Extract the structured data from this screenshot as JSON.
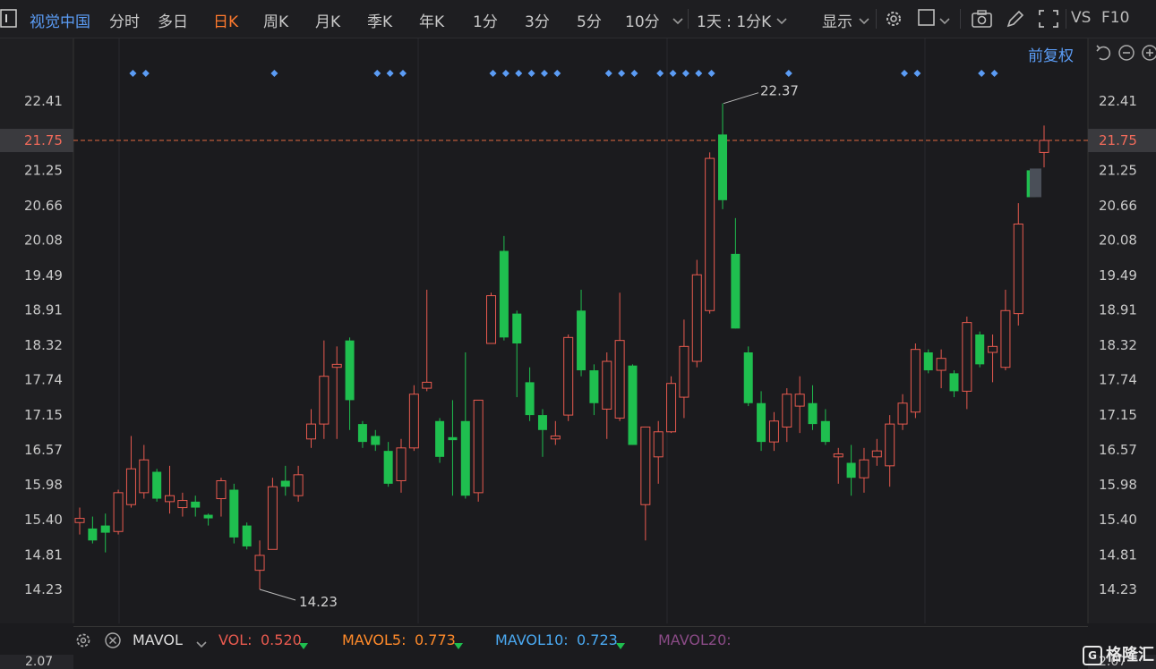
{
  "toolbar": {
    "title": "视觉中国",
    "tabs": [
      "分时",
      "多日",
      "日K",
      "周K",
      "月K",
      "季K",
      "年K",
      "1分",
      "3分",
      "5分",
      "10分"
    ],
    "active_tab": "日K",
    "period_select": "1天 : 1分K",
    "display_label": "显示",
    "vs": "VS",
    "f10": "F10"
  },
  "fq_label": "前复权",
  "price_axis": {
    "ticks": [
      "22.41",
      "21.75",
      "21.25",
      "20.66",
      "20.08",
      "19.49",
      "18.91",
      "18.32",
      "17.74",
      "17.15",
      "16.57",
      "15.98",
      "15.40",
      "14.81",
      "14.23"
    ],
    "current": "21.75",
    "max_label": "22.37",
    "min_label": "14.23"
  },
  "chart_data": {
    "type": "candlestick",
    "ylim": [
      13.5,
      23.4
    ],
    "candles": [
      {
        "o": 15.35,
        "c": 15.42,
        "h": 15.6,
        "l": 15.15
      },
      {
        "o": 15.25,
        "c": 15.05,
        "h": 15.45,
        "l": 15.0
      },
      {
        "o": 15.3,
        "c": 15.18,
        "h": 15.5,
        "l": 14.85
      },
      {
        "o": 15.2,
        "c": 15.85,
        "h": 15.9,
        "l": 15.15
      },
      {
        "o": 15.65,
        "c": 16.25,
        "h": 16.8,
        "l": 15.6
      },
      {
        "o": 15.85,
        "c": 16.4,
        "h": 16.65,
        "l": 15.75
      },
      {
        "o": 16.2,
        "c": 15.75,
        "h": 16.25,
        "l": 15.7
      },
      {
        "o": 15.7,
        "c": 15.8,
        "h": 16.3,
        "l": 15.5
      },
      {
        "o": 15.6,
        "c": 15.72,
        "h": 15.85,
        "l": 15.45
      },
      {
        "o": 15.7,
        "c": 15.6,
        "h": 15.8,
        "l": 15.45
      },
      {
        "o": 15.48,
        "c": 15.42,
        "h": 15.5,
        "l": 15.3
      },
      {
        "o": 15.75,
        "c": 16.05,
        "h": 16.1,
        "l": 15.45
      },
      {
        "o": 15.9,
        "c": 15.1,
        "h": 16.0,
        "l": 15.0
      },
      {
        "o": 15.3,
        "c": 14.95,
        "h": 15.35,
        "l": 14.9
      },
      {
        "o": 14.55,
        "c": 14.8,
        "h": 15.05,
        "l": 14.23
      },
      {
        "o": 14.9,
        "c": 15.95,
        "h": 16.1,
        "l": 14.9
      },
      {
        "o": 16.05,
        "c": 15.95,
        "h": 16.3,
        "l": 15.8
      },
      {
        "o": 15.8,
        "c": 16.15,
        "h": 16.3,
        "l": 15.7
      },
      {
        "o": 16.75,
        "c": 17.0,
        "h": 17.25,
        "l": 16.6
      },
      {
        "o": 17.0,
        "c": 17.8,
        "h": 18.4,
        "l": 16.75
      },
      {
        "o": 17.95,
        "c": 18.0,
        "h": 18.3,
        "l": 16.75
      },
      {
        "o": 18.4,
        "c": 17.4,
        "h": 18.45,
        "l": 16.9
      },
      {
        "o": 17.0,
        "c": 16.7,
        "h": 17.05,
        "l": 16.6
      },
      {
        "o": 16.8,
        "c": 16.65,
        "h": 16.9,
        "l": 16.55
      },
      {
        "o": 16.55,
        "c": 16.0,
        "h": 16.7,
        "l": 15.95
      },
      {
        "o": 16.05,
        "c": 16.6,
        "h": 16.75,
        "l": 15.85
      },
      {
        "o": 16.6,
        "c": 17.5,
        "h": 17.65,
        "l": 16.55
      },
      {
        "o": 17.6,
        "c": 17.7,
        "h": 19.25,
        "l": 17.55
      },
      {
        "o": 17.05,
        "c": 16.45,
        "h": 17.1,
        "l": 16.35
      },
      {
        "o": 16.78,
        "c": 16.73,
        "h": 17.4,
        "l": 15.8
      },
      {
        "o": 17.05,
        "c": 15.8,
        "h": 18.2,
        "l": 15.75
      },
      {
        "o": 15.85,
        "c": 17.4,
        "h": 17.4,
        "l": 15.7
      },
      {
        "o": 18.35,
        "c": 19.15,
        "h": 19.2,
        "l": 18.35
      },
      {
        "o": 19.9,
        "c": 18.45,
        "h": 20.15,
        "l": 18.4
      },
      {
        "o": 18.85,
        "c": 18.35,
        "h": 18.9,
        "l": 17.45
      },
      {
        "o": 17.7,
        "c": 17.15,
        "h": 17.95,
        "l": 17.05
      },
      {
        "o": 17.15,
        "c": 16.9,
        "h": 17.25,
        "l": 16.45
      },
      {
        "o": 16.75,
        "c": 16.8,
        "h": 17.05,
        "l": 16.65
      },
      {
        "o": 17.15,
        "c": 18.45,
        "h": 18.5,
        "l": 17.05
      },
      {
        "o": 18.9,
        "c": 17.9,
        "h": 19.25,
        "l": 17.8
      },
      {
        "o": 17.9,
        "c": 17.35,
        "h": 18.0,
        "l": 17.15
      },
      {
        "o": 17.25,
        "c": 18.05,
        "h": 18.2,
        "l": 16.75
      },
      {
        "o": 17.1,
        "c": 18.4,
        "h": 19.2,
        "l": 17.05
      },
      {
        "o": 17.98,
        "c": 16.65,
        "h": 18.0,
        "l": 16.65
      },
      {
        "o": 15.65,
        "c": 16.95,
        "h": 16.95,
        "l": 15.05
      },
      {
        "o": 16.45,
        "c": 16.87,
        "h": 17.05,
        "l": 16.0
      },
      {
        "o": 16.87,
        "c": 17.68,
        "h": 17.8,
        "l": 16.85
      },
      {
        "o": 17.45,
        "c": 18.3,
        "h": 18.75,
        "l": 17.1
      },
      {
        "o": 18.05,
        "c": 19.5,
        "h": 19.75,
        "l": 17.95
      },
      {
        "o": 18.9,
        "c": 21.45,
        "h": 21.55,
        "l": 18.85
      },
      {
        "o": 21.85,
        "c": 20.75,
        "h": 22.37,
        "l": 20.6
      },
      {
        "o": 19.85,
        "c": 18.6,
        "h": 20.45,
        "l": 18.6
      },
      {
        "o": 18.2,
        "c": 17.35,
        "h": 18.3,
        "l": 17.3
      },
      {
        "o": 17.35,
        "c": 16.7,
        "h": 17.55,
        "l": 16.55
      },
      {
        "o": 16.7,
        "c": 17.05,
        "h": 17.2,
        "l": 16.55
      },
      {
        "o": 16.95,
        "c": 17.5,
        "h": 17.6,
        "l": 16.7
      },
      {
        "o": 17.3,
        "c": 17.5,
        "h": 17.8,
        "l": 16.85
      },
      {
        "o": 17.35,
        "c": 17.0,
        "h": 17.65,
        "l": 16.9
      },
      {
        "o": 17.05,
        "c": 16.7,
        "h": 17.25,
        "l": 16.65
      },
      {
        "o": 16.45,
        "c": 16.5,
        "h": 16.6,
        "l": 16.0
      },
      {
        "o": 16.35,
        "c": 16.1,
        "h": 16.65,
        "l": 15.8
      },
      {
        "o": 16.1,
        "c": 16.4,
        "h": 16.6,
        "l": 15.85
      },
      {
        "o": 16.45,
        "c": 16.55,
        "h": 16.75,
        "l": 16.3
      },
      {
        "o": 16.3,
        "c": 17.0,
        "h": 17.15,
        "l": 15.95
      },
      {
        "o": 17.0,
        "c": 17.35,
        "h": 17.5,
        "l": 16.9
      },
      {
        "o": 17.2,
        "c": 18.25,
        "h": 18.35,
        "l": 17.1
      },
      {
        "o": 18.2,
        "c": 17.9,
        "h": 18.25,
        "l": 17.85
      },
      {
        "o": 17.9,
        "c": 18.1,
        "h": 18.25,
        "l": 17.6
      },
      {
        "o": 17.85,
        "c": 17.55,
        "h": 17.9,
        "l": 17.45
      },
      {
        "o": 17.55,
        "c": 18.7,
        "h": 18.8,
        "l": 17.25
      },
      {
        "o": 18.5,
        "c": 18.0,
        "h": 18.55,
        "l": 17.95
      },
      {
        "o": 18.2,
        "c": 18.3,
        "h": 18.5,
        "l": 17.7
      },
      {
        "o": 17.95,
        "c": 18.9,
        "h": 19.25,
        "l": 17.9
      },
      {
        "o": 18.85,
        "c": 20.35,
        "h": 20.7,
        "l": 18.65
      },
      {
        "o": 21.25,
        "c": 20.8,
        "h": 21.25,
        "l": 20.8
      },
      {
        "o": 21.55,
        "c": 21.75,
        "h": 22.0,
        "l": 21.3
      }
    ],
    "marker_indexes": [
      4,
      5,
      15,
      23,
      24,
      25,
      32,
      33,
      34,
      35,
      36,
      37,
      41,
      42,
      43,
      45,
      46,
      47,
      48,
      49,
      55,
      64,
      65,
      70,
      71
    ]
  },
  "vol_bar": {
    "name": "MAVOL",
    "vol_label": "VOL:",
    "vol_value": "0.520",
    "ma5_label": "MAVOL5:",
    "ma5_value": "0.773",
    "ma10_label": "MAVOL10:",
    "ma10_value": "0.723",
    "ma20_label": "MAVOL20:",
    "axis_value": "2.07"
  },
  "watermark": "格隆汇",
  "colors": {
    "up": "#e85a4f",
    "down": "#1fbf4f",
    "accent": "#ff7a2e",
    "blue": "#5b9cf5"
  }
}
